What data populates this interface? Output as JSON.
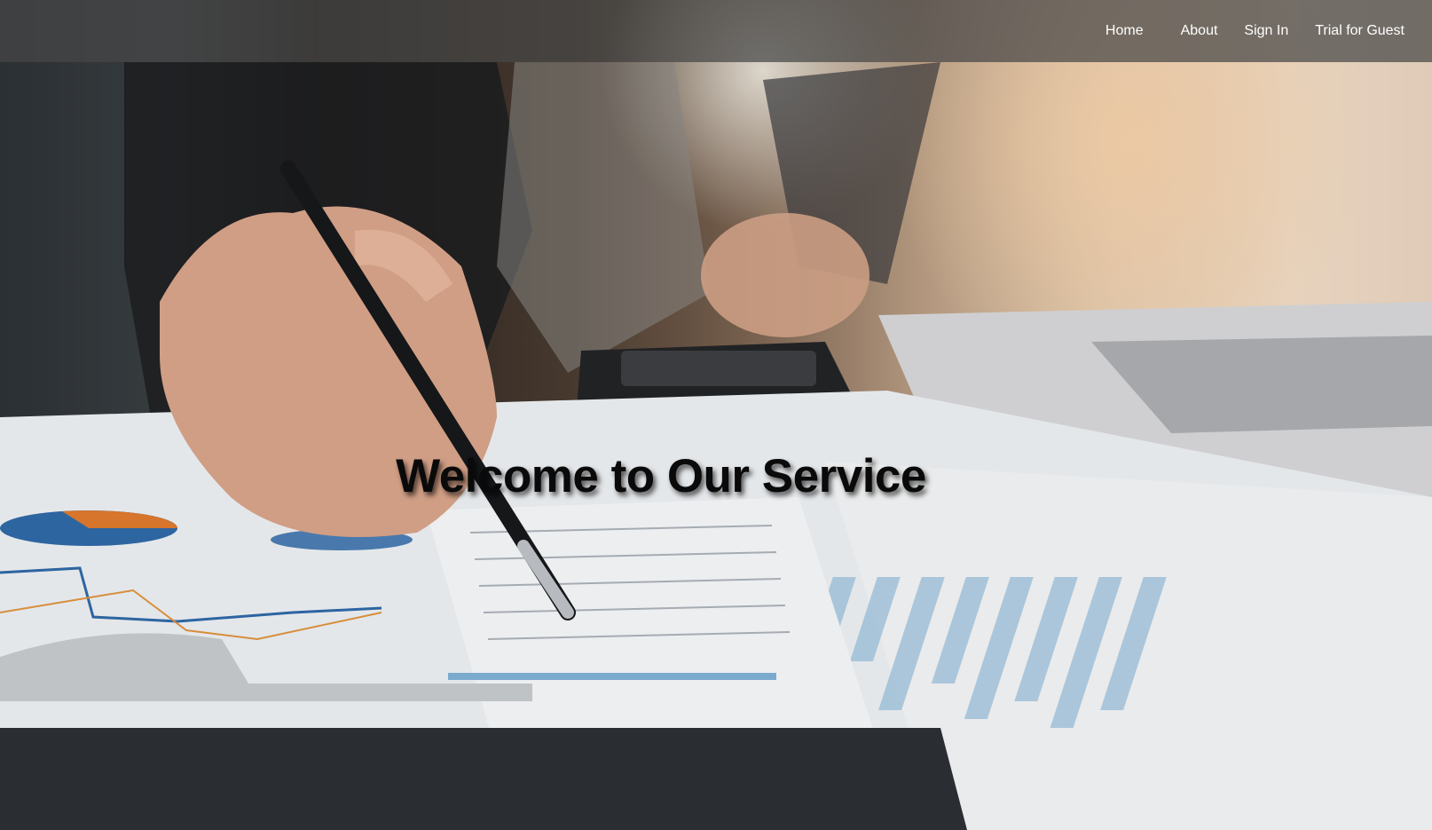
{
  "nav": {
    "links": [
      {
        "label": "Home"
      },
      {
        "label": "About"
      },
      {
        "label": "Sign In"
      },
      {
        "label": "Trial for Guest"
      }
    ]
  },
  "hero": {
    "title": "Welcome to Our Service",
    "image_description_icon": "hero-photo-icon"
  },
  "colors": {
    "navbar_bg": "#464646",
    "nav_text": "#ffffff",
    "title_text": "#0a0a0a"
  }
}
